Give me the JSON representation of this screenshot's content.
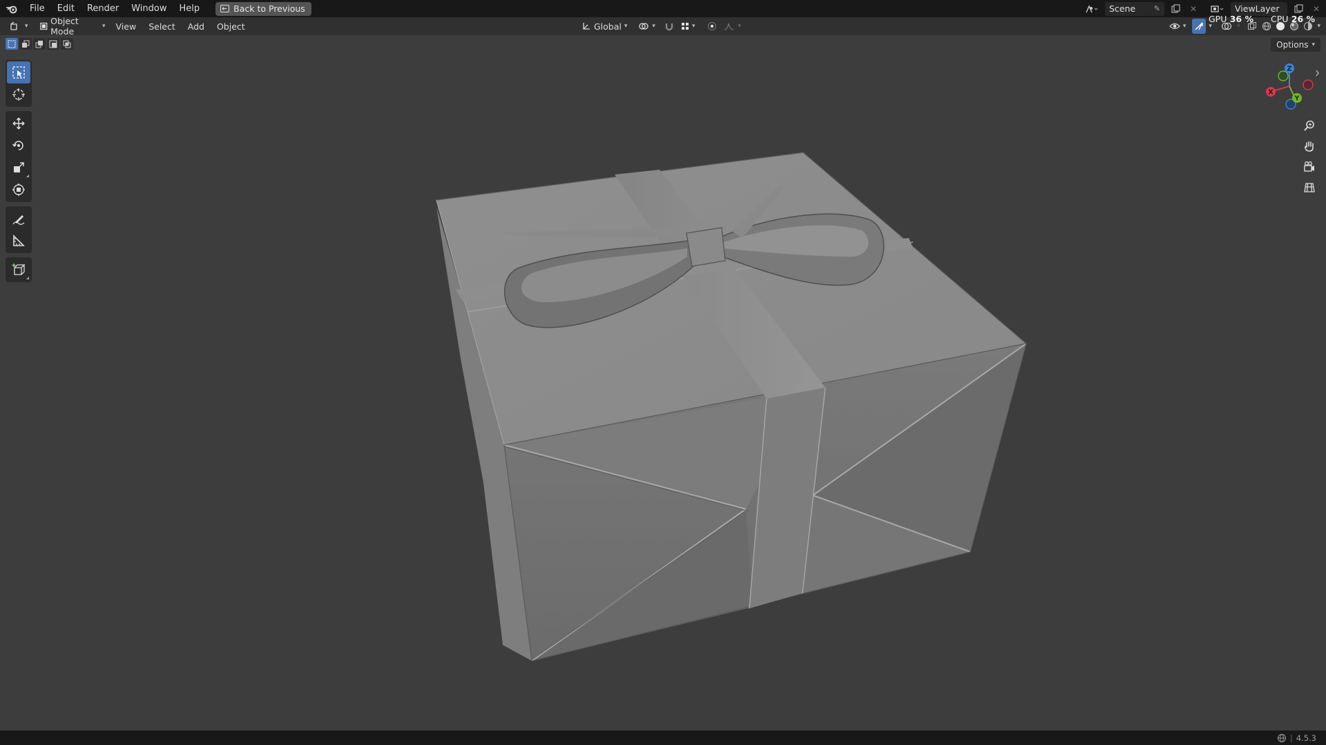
{
  "topbar": {
    "menus": [
      "File",
      "Edit",
      "Render",
      "Window",
      "Help"
    ],
    "back_button": "Back to Previous",
    "scene": "Scene",
    "view_layer": "ViewLayer"
  },
  "header": {
    "mode": "Object Mode",
    "menus": [
      "View",
      "Select",
      "Add",
      "Object"
    ],
    "transform_orientation": "Global"
  },
  "stats": {
    "gpu_label": "GPU",
    "gpu_value": "36 %",
    "cpu_label": "CPU",
    "cpu_value": "26 %"
  },
  "viewport": {
    "options_label": "Options"
  },
  "gizmo": {
    "z_label": "Z",
    "x_label": "X",
    "y_label": "Y",
    "colors": {
      "x": "#d63a4d",
      "y": "#73b52e",
      "z": "#3b83dd"
    }
  },
  "toolbar": {
    "tools": [
      "select-box",
      "cursor",
      "move",
      "rotate",
      "scale",
      "transform",
      "annotate",
      "measure",
      "add-cube"
    ],
    "active": "select-box"
  },
  "statusbar": {
    "version": "4.5.3"
  },
  "colors": {
    "accent": "#4772b3",
    "background": "#3d3d3d",
    "topbar": "#181818",
    "header": "#303030"
  }
}
